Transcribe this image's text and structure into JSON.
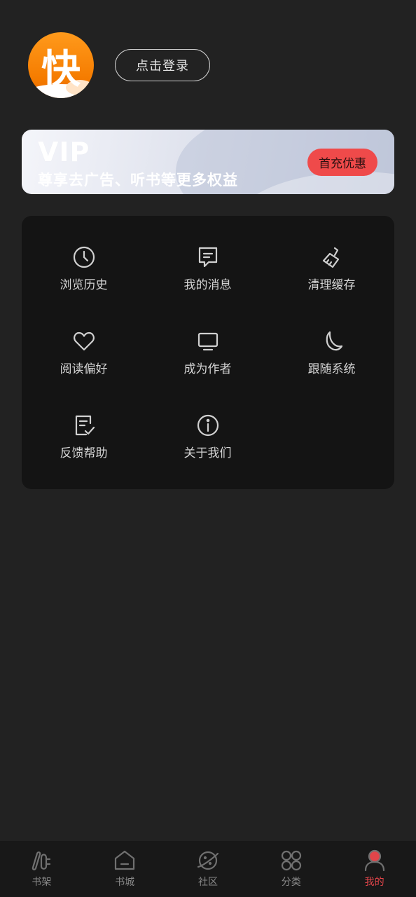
{
  "profile": {
    "avatar_char": "快",
    "login_label": "点击登录"
  },
  "vip": {
    "title": "VIP",
    "subtitle": "尊享去广告、听书等更多权益",
    "button_label": "首充优惠"
  },
  "menu": {
    "items": [
      {
        "label": "浏览历史",
        "icon": "clock-icon"
      },
      {
        "label": "我的消息",
        "icon": "message-icon"
      },
      {
        "label": "清理缓存",
        "icon": "broom-icon"
      },
      {
        "label": "阅读偏好",
        "icon": "heart-icon"
      },
      {
        "label": "成为作者",
        "icon": "monitor-icon"
      },
      {
        "label": "跟随系统",
        "icon": "moon-icon"
      },
      {
        "label": "反馈帮助",
        "icon": "feedback-icon"
      },
      {
        "label": "关于我们",
        "icon": "info-icon"
      }
    ]
  },
  "tabbar": {
    "items": [
      {
        "label": "书架",
        "icon": "bookshelf-icon"
      },
      {
        "label": "书城",
        "icon": "bookstore-icon"
      },
      {
        "label": "社区",
        "icon": "planet-icon"
      },
      {
        "label": "分类",
        "icon": "category-icon"
      },
      {
        "label": "我的",
        "icon": "profile-icon"
      }
    ],
    "active_index": 4
  },
  "colors": {
    "background": "#222222",
    "card": "#141414",
    "accent": "#e0454a",
    "avatar_orange": "#f57c00"
  }
}
